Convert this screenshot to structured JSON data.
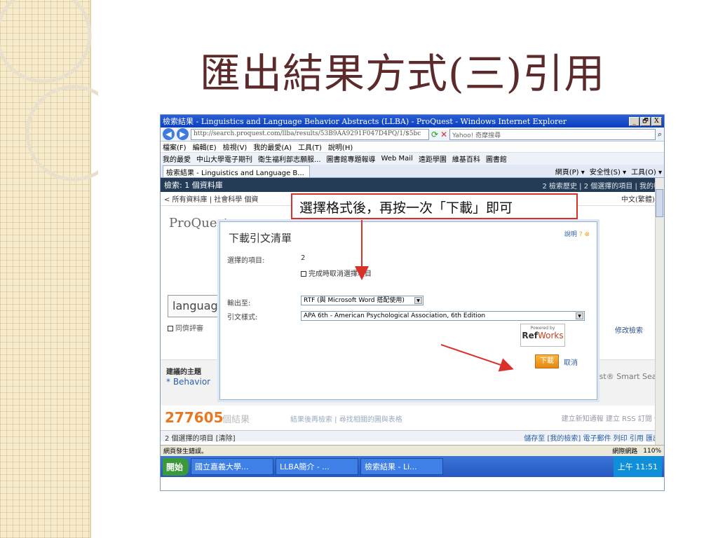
{
  "slide": {
    "title": "匯出結果方式(三)引用"
  },
  "browser": {
    "window_title": "檢索結果 - Linguistics and Language Behavior Abstracts (LLBA) - ProQuest - Windows Internet Explorer",
    "window_buttons": [
      "_",
      "🗗",
      "X"
    ],
    "url": "http://search.proquest.com/llba/results/53B9AA9291F047D4PQ/1/$5bc",
    "search_placeholder": "Yahoo! 奇摩搜尋",
    "menu": [
      "檔案(F)",
      "編輯(E)",
      "檢視(V)",
      "我的最愛(A)",
      "工具(T)",
      "說明(H)"
    ],
    "favorites": [
      "我的最愛",
      "中山大學電子期刊",
      "衛生福利部志願服...",
      "圖書館專題報導",
      "Web Mail",
      "遠距學園",
      "維基百科",
      "圖書館"
    ],
    "tab_title": "檢索結果 - Linguistics and Language B...",
    "tab_tools": [
      "網頁(P) ▾",
      "安全性(S) ▾",
      "工具(O) ▾"
    ],
    "status_text": "網頁發生錯誤。",
    "status_zone": "網際網路",
    "zoom": "110%"
  },
  "proquest": {
    "topbar_search": "檢索: 1 個資料庫",
    "topbar_right": "2 檢索歷史 | 2 個選擇的項目 | 我的檢",
    "db_links": "< 所有資料庫 | 社會科學 個資",
    "db_right": "中文(繁體) ▾",
    "logo": "ProQuest",
    "query": "languag",
    "peer_review": "同儕評審",
    "modify_search": "修改檢索",
    "suggest_title": "建議的主題",
    "suggest_value": "* Behavior",
    "smart_search": "est® Smart Sear",
    "result_count": "277605",
    "result_suffix": "個結果",
    "result_middle": "結果後再檢索 | 尋找相關的圖與表格",
    "result_right": "建立新知通報  建立 RSS 訂閱  儲",
    "selected_bar": "2 個選擇的項目 [清除]",
    "selected_right": "儲存至 [我的檢索]  電子郵件  列印  引用  匯出"
  },
  "modal": {
    "title": "下載引文清單",
    "help": "說明",
    "selected_label": "選擇的項目:",
    "selected_count": "2",
    "clear_on_finish": "完成時取消選擇項目",
    "output_label": "輸出至:",
    "output_value": "RTF (與 Microsoft Word 搭配使用)",
    "style_label": "引文樣式:",
    "style_value": "APA 6th - American Psychological Association, 6th Edition",
    "powered_by": "Powered by",
    "refworks_ref": "Ref",
    "refworks_works": "Works",
    "download": "下載",
    "cancel": "取消"
  },
  "annotation": {
    "callout": "選擇格式後，再按一次「下載」即可"
  },
  "taskbar": {
    "start": "開始",
    "items": [
      "國立嘉義大學...",
      "LLBA簡介 - ...",
      "檢索結果 - Li..."
    ],
    "clock": "上午 11:51"
  },
  "colors": {
    "title": "#5c2a2a",
    "callout_border": "#d9312a",
    "download_button": "#f0a030",
    "proquest_bar": "#243c55"
  }
}
